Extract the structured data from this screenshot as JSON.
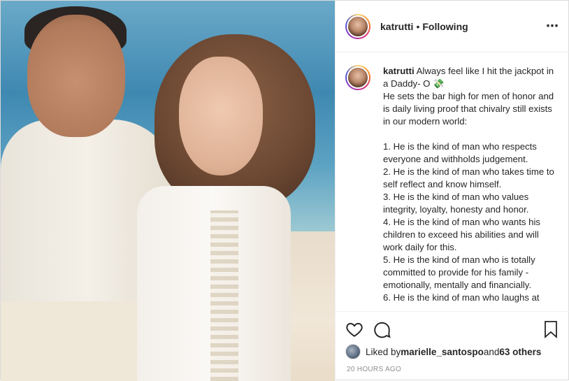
{
  "post": {
    "username": "katrutti",
    "follow_status": "Following",
    "separator": "•",
    "more_icon": "⋯"
  },
  "caption": {
    "username": "katrutti",
    "text": " Always feel like I hit the jackpot in a Daddy- O 💸\nHe sets the bar high for men of honor and is daily living proof that chivalry still exists in our modern world:\n\n1. He is the kind of man who respects everyone and withholds judgement.\n2. He is the kind of man who takes time to self reflect and know himself.\n3. He is the kind of man who values integrity, loyalty, honesty and honor.\n4. He is the kind of man who wants his children to exceed his abilities and will work daily for this.\n5. He is the kind of man who is totally committed to provide for his family - emotionally, mentally and financially.\n6. He is the kind of man who laughs at"
  },
  "likes": {
    "prefix": "Liked by ",
    "user": "marielle_santospo",
    "middle": " and ",
    "others": "63 others"
  },
  "timestamp": "20 HOURS AGO",
  "icons": [
    "heart-icon",
    "comment-icon",
    "bookmark-icon",
    "more-icon"
  ]
}
